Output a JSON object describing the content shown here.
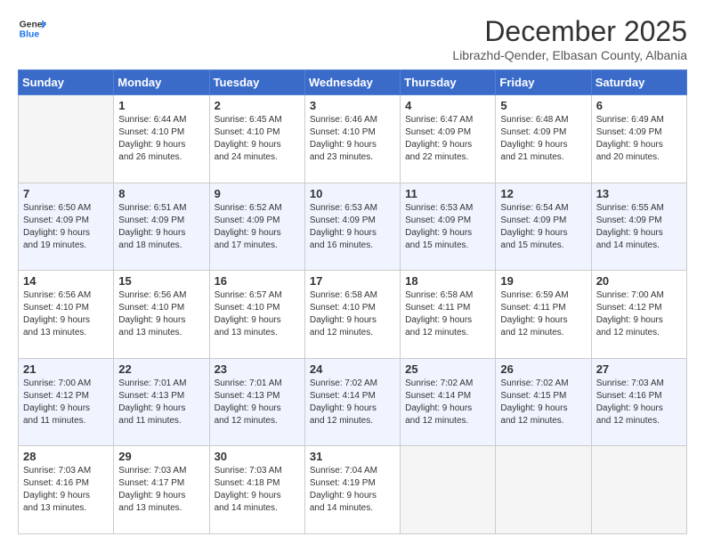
{
  "logo": {
    "line1": "General",
    "line2": "Blue"
  },
  "title": "December 2025",
  "subtitle": "Librazhd-Qender, Elbasan County, Albania",
  "days_header": [
    "Sunday",
    "Monday",
    "Tuesday",
    "Wednesday",
    "Thursday",
    "Friday",
    "Saturday"
  ],
  "weeks": [
    [
      {
        "day": "",
        "info": ""
      },
      {
        "day": "1",
        "info": "Sunrise: 6:44 AM\nSunset: 4:10 PM\nDaylight: 9 hours\nand 26 minutes."
      },
      {
        "day": "2",
        "info": "Sunrise: 6:45 AM\nSunset: 4:10 PM\nDaylight: 9 hours\nand 24 minutes."
      },
      {
        "day": "3",
        "info": "Sunrise: 6:46 AM\nSunset: 4:10 PM\nDaylight: 9 hours\nand 23 minutes."
      },
      {
        "day": "4",
        "info": "Sunrise: 6:47 AM\nSunset: 4:09 PM\nDaylight: 9 hours\nand 22 minutes."
      },
      {
        "day": "5",
        "info": "Sunrise: 6:48 AM\nSunset: 4:09 PM\nDaylight: 9 hours\nand 21 minutes."
      },
      {
        "day": "6",
        "info": "Sunrise: 6:49 AM\nSunset: 4:09 PM\nDaylight: 9 hours\nand 20 minutes."
      }
    ],
    [
      {
        "day": "7",
        "info": "Sunrise: 6:50 AM\nSunset: 4:09 PM\nDaylight: 9 hours\nand 19 minutes."
      },
      {
        "day": "8",
        "info": "Sunrise: 6:51 AM\nSunset: 4:09 PM\nDaylight: 9 hours\nand 18 minutes."
      },
      {
        "day": "9",
        "info": "Sunrise: 6:52 AM\nSunset: 4:09 PM\nDaylight: 9 hours\nand 17 minutes."
      },
      {
        "day": "10",
        "info": "Sunrise: 6:53 AM\nSunset: 4:09 PM\nDaylight: 9 hours\nand 16 minutes."
      },
      {
        "day": "11",
        "info": "Sunrise: 6:53 AM\nSunset: 4:09 PM\nDaylight: 9 hours\nand 15 minutes."
      },
      {
        "day": "12",
        "info": "Sunrise: 6:54 AM\nSunset: 4:09 PM\nDaylight: 9 hours\nand 15 minutes."
      },
      {
        "day": "13",
        "info": "Sunrise: 6:55 AM\nSunset: 4:09 PM\nDaylight: 9 hours\nand 14 minutes."
      }
    ],
    [
      {
        "day": "14",
        "info": "Sunrise: 6:56 AM\nSunset: 4:10 PM\nDaylight: 9 hours\nand 13 minutes."
      },
      {
        "day": "15",
        "info": "Sunrise: 6:56 AM\nSunset: 4:10 PM\nDaylight: 9 hours\nand 13 minutes."
      },
      {
        "day": "16",
        "info": "Sunrise: 6:57 AM\nSunset: 4:10 PM\nDaylight: 9 hours\nand 13 minutes."
      },
      {
        "day": "17",
        "info": "Sunrise: 6:58 AM\nSunset: 4:10 PM\nDaylight: 9 hours\nand 12 minutes."
      },
      {
        "day": "18",
        "info": "Sunrise: 6:58 AM\nSunset: 4:11 PM\nDaylight: 9 hours\nand 12 minutes."
      },
      {
        "day": "19",
        "info": "Sunrise: 6:59 AM\nSunset: 4:11 PM\nDaylight: 9 hours\nand 12 minutes."
      },
      {
        "day": "20",
        "info": "Sunrise: 7:00 AM\nSunset: 4:12 PM\nDaylight: 9 hours\nand 12 minutes."
      }
    ],
    [
      {
        "day": "21",
        "info": "Sunrise: 7:00 AM\nSunset: 4:12 PM\nDaylight: 9 hours\nand 11 minutes."
      },
      {
        "day": "22",
        "info": "Sunrise: 7:01 AM\nSunset: 4:13 PM\nDaylight: 9 hours\nand 11 minutes."
      },
      {
        "day": "23",
        "info": "Sunrise: 7:01 AM\nSunset: 4:13 PM\nDaylight: 9 hours\nand 12 minutes."
      },
      {
        "day": "24",
        "info": "Sunrise: 7:02 AM\nSunset: 4:14 PM\nDaylight: 9 hours\nand 12 minutes."
      },
      {
        "day": "25",
        "info": "Sunrise: 7:02 AM\nSunset: 4:14 PM\nDaylight: 9 hours\nand 12 minutes."
      },
      {
        "day": "26",
        "info": "Sunrise: 7:02 AM\nSunset: 4:15 PM\nDaylight: 9 hours\nand 12 minutes."
      },
      {
        "day": "27",
        "info": "Sunrise: 7:03 AM\nSunset: 4:16 PM\nDaylight: 9 hours\nand 12 minutes."
      }
    ],
    [
      {
        "day": "28",
        "info": "Sunrise: 7:03 AM\nSunset: 4:16 PM\nDaylight: 9 hours\nand 13 minutes."
      },
      {
        "day": "29",
        "info": "Sunrise: 7:03 AM\nSunset: 4:17 PM\nDaylight: 9 hours\nand 13 minutes."
      },
      {
        "day": "30",
        "info": "Sunrise: 7:03 AM\nSunset: 4:18 PM\nDaylight: 9 hours\nand 14 minutes."
      },
      {
        "day": "31",
        "info": "Sunrise: 7:04 AM\nSunset: 4:19 PM\nDaylight: 9 hours\nand 14 minutes."
      },
      {
        "day": "",
        "info": ""
      },
      {
        "day": "",
        "info": ""
      },
      {
        "day": "",
        "info": ""
      }
    ]
  ]
}
